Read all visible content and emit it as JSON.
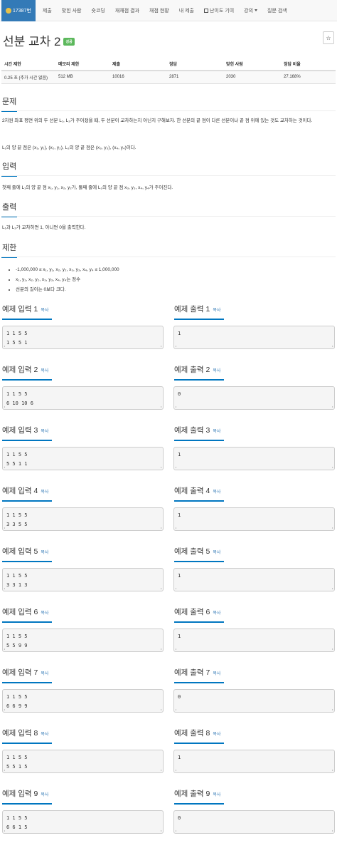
{
  "nav": {
    "tabs": [
      {
        "label": "17387번"
      },
      {
        "label": "제출"
      },
      {
        "label": "맞힌 사람"
      },
      {
        "label": "숏코딩"
      },
      {
        "label": "재채점 결과"
      },
      {
        "label": "채점 현황"
      },
      {
        "label": "내 제출"
      },
      {
        "label": "난이도 기여"
      },
      {
        "label": "강의"
      },
      {
        "label": "질문 검색"
      }
    ]
  },
  "problem": {
    "title": "선분 교차 2",
    "badge": "성공",
    "star": "☆"
  },
  "info": {
    "headers": [
      "시간 제한",
      "메모리 제한",
      "제출",
      "정답",
      "맞힌 사람",
      "정답 비율"
    ],
    "values": [
      "0.25 초 (추가 시간 없음)",
      "512 MB",
      "10016",
      "2871",
      "2030",
      "27.168%"
    ]
  },
  "sections": {
    "problem_h": "문제",
    "problem_p1": "2차원 좌표 평면 위의 두 선분 L₁, L₂가 주어졌을 때, 두 선분이 교차하는지 아닌지 구해보자. 한 선분의 끝 점이 다른 선분이나 끝 점 위에 있는 것도 교차하는 것이다.",
    "problem_p2": "L₁의 양 끝 점은 (x₁, y₁), (x₂, y₂), L₂의 양 끝 점은 (x₃, y₃), (x₄, y₄)이다.",
    "input_h": "입력",
    "input_p": "첫째 줄에 L₁의 양 끝 점 x₁, y₁, x₂, y₂가, 둘째 줄에 L₂의 양 끝 점 x₃, y₃, x₄, y₄가 주어진다.",
    "output_h": "출력",
    "output_p": "L₁과 L₂가 교차하면 1, 아니면 0을 출력한다.",
    "limit_h": "제한",
    "limits": [
      "-1,000,000 ≤ x₁, y₁, x₂, y₂, x₃, y₃, x₄, y₄ ≤ 1,000,000",
      "x₁, y₁, x₂, y₂, x₃, y₃, x₄, y₄는 정수",
      "선분의 길이는 0보다 크다."
    ]
  },
  "samples": {
    "copy_label": "복사",
    "items": [
      {
        "in_title": "예제 입력 1",
        "out_title": "예제 출력 1",
        "input": "1 1 5 5\n1 5 5 1",
        "output": "1"
      },
      {
        "in_title": "예제 입력 2",
        "out_title": "예제 출력 2",
        "input": "1 1 5 5\n6 10 10 6",
        "output": "0"
      },
      {
        "in_title": "예제 입력 3",
        "out_title": "예제 출력 3",
        "input": "1 1 5 5\n5 5 1 1",
        "output": "1"
      },
      {
        "in_title": "예제 입력 4",
        "out_title": "예제 출력 4",
        "input": "1 1 5 5\n3 3 5 5",
        "output": "1"
      },
      {
        "in_title": "예제 입력 5",
        "out_title": "예제 출력 5",
        "input": "1 1 5 5\n3 3 1 3",
        "output": "1"
      },
      {
        "in_title": "예제 입력 6",
        "out_title": "예제 출력 6",
        "input": "1 1 5 5\n5 5 9 9",
        "output": "1"
      },
      {
        "in_title": "예제 입력 7",
        "out_title": "예제 출력 7",
        "input": "1 1 5 5\n6 6 9 9",
        "output": "0"
      },
      {
        "in_title": "예제 입력 8",
        "out_title": "예제 출력 8",
        "input": "1 1 5 5\n5 5 1 5",
        "output": "1"
      },
      {
        "in_title": "예제 입력 9",
        "out_title": "예제 출력 9",
        "input": "1 1 5 5\n6 6 1 5",
        "output": "0"
      }
    ]
  }
}
